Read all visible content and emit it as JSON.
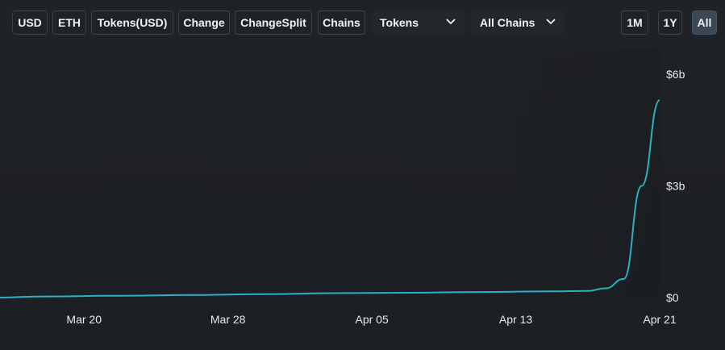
{
  "toolbar": {
    "buttons": [
      {
        "label": "USD",
        "active": true
      },
      {
        "label": "ETH",
        "active": false
      },
      {
        "label": "Tokens(USD)",
        "active": false
      },
      {
        "label": "Change",
        "active": false
      },
      {
        "label": "ChangeSplit",
        "active": false
      },
      {
        "label": "Chains",
        "active": false
      }
    ],
    "dropdowns": [
      {
        "selected": "Tokens"
      },
      {
        "selected": "All Chains"
      }
    ],
    "ranges": [
      {
        "label": "1M",
        "active": false
      },
      {
        "label": "1Y",
        "active": false
      },
      {
        "label": "All",
        "active": true
      }
    ]
  },
  "colors": {
    "line": "#2ab2c4",
    "background": "#1e2126",
    "active_button": "#3b4752"
  },
  "chart_data": {
    "type": "line",
    "title": "",
    "xlabel": "",
    "ylabel": "",
    "x_tick_labels": [
      "Mar 20",
      "Mar 28",
      "Apr 05",
      "Apr 13",
      "Apr 21"
    ],
    "y_tick_labels": [
      "$0",
      "$3b",
      "$6b"
    ],
    "ylim": [
      0,
      6
    ],
    "y_unit": "billion USD",
    "y_axis_side": "right",
    "grid": false,
    "series": [
      {
        "values": [
          {
            "x": "2024-03-15",
            "y": 0.0
          },
          {
            "x": "2024-03-18",
            "y": 0.03
          },
          {
            "x": "2024-03-22",
            "y": 0.05
          },
          {
            "x": "2024-03-26",
            "y": 0.07
          },
          {
            "x": "2024-03-30",
            "y": 0.09
          },
          {
            "x": "2024-04-03",
            "y": 0.12
          },
          {
            "x": "2024-04-07",
            "y": 0.13
          },
          {
            "x": "2024-04-11",
            "y": 0.15
          },
          {
            "x": "2024-04-15",
            "y": 0.17
          },
          {
            "x": "2024-04-17",
            "y": 0.18
          },
          {
            "x": "2024-04-18",
            "y": 0.25
          },
          {
            "x": "2024-04-19",
            "y": 0.5
          },
          {
            "x": "2024-04-20",
            "y": 3.0
          },
          {
            "x": "2024-04-21",
            "y": 5.3
          }
        ]
      }
    ]
  }
}
